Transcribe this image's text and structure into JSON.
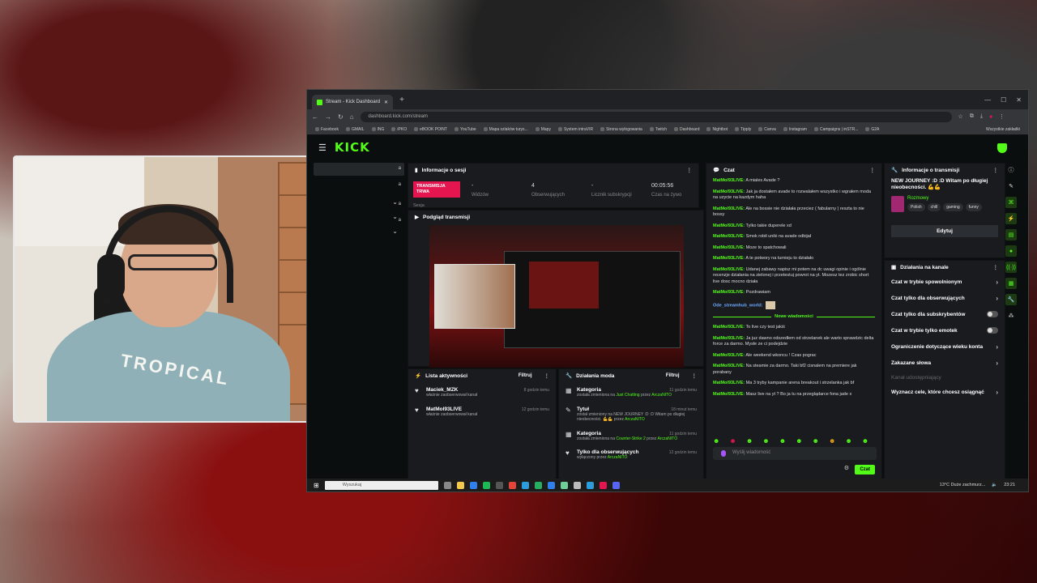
{
  "browser": {
    "tab_title": "Stream - Kick Dashboard",
    "url": "dashboard.kick.com/stream",
    "bookmarks": [
      "Facebook",
      "GMAIL",
      "ING",
      "iPKO",
      "eBOOK POINT",
      "YouTube",
      "Mapa szlaków turys...",
      "Mapy",
      "System intraVIR",
      "Strona wylogowania",
      "Twitch",
      "Dashboard",
      "Nightbot",
      "Tipply",
      "Canva",
      "Instagram",
      "Campaigns | inSTR...",
      "G2A"
    ],
    "bookmarks_other": "Wszystkie zakładki"
  },
  "app": {
    "logo": "KICK"
  },
  "sidebar": {
    "items": [
      "a",
      "a",
      "a",
      "a"
    ]
  },
  "session": {
    "title": "Informacje o sesji",
    "live_label": "TRANSMISJA TRWA",
    "session_label": "Sesja",
    "stats": [
      {
        "value": "-",
        "label": "Widzów"
      },
      {
        "value": "4",
        "label": "Obserwujących"
      },
      {
        "value": "-",
        "label": "Licznik subskrypcji"
      },
      {
        "value": "00:05:56",
        "label": "Czas na żywo"
      }
    ]
  },
  "preview": {
    "title": "Podgląd transmisji"
  },
  "activity": {
    "title": "Lista aktywności",
    "filter": "Filtruj",
    "items": [
      {
        "user": "Maciek_MZK",
        "text": "właśnie zaobserwował kanał",
        "time": "8 godzin temu"
      },
      {
        "user": "MatMol93LIVE",
        "text": "właśnie zaobserwował kanał",
        "time": "12 godzin temu"
      }
    ]
  },
  "mod": {
    "title": "Działania moda",
    "filter": "Filtruj",
    "items": [
      {
        "title": "Kategoria",
        "pre": "została zmieniona na ",
        "value": "Just Chatting",
        "mid": " przez ",
        "by": "ArczaNITO",
        "time": "11 godzin temu"
      },
      {
        "title": "Tytuł",
        "pre": "został zmieniony na NEW JOURNEY :D :D Witam po długiej nieobecności. 💪💪",
        "value": "",
        "mid": " przez ",
        "by": "ArczaNITO",
        "time": "18 minut temu"
      },
      {
        "title": "Kategoria",
        "pre": "została zmieniona na ",
        "value": "Counter-Strike 2",
        "mid": " przez ",
        "by": "ArczaNITO",
        "time": "11 godzin temu"
      },
      {
        "title": "Tylko dla obserwujących",
        "pre": "wyłączony przez ",
        "value": "",
        "mid": "",
        "by": "ArczaNITO",
        "time": "12 godzin temu"
      }
    ]
  },
  "chat": {
    "title": "Czat",
    "messages": [
      {
        "user": "MatMol93LIVE:",
        "text": "A miales Avade ?"
      },
      {
        "user": "MatMol93LIVE:",
        "text": "Jak ja dostałem avade to rozwalałem wszystko i wgrałem moda na uzycie na kazdym haha"
      },
      {
        "user": "MatMol93LIVE:",
        "text": "Ale na bossie nie działała przeciez ( fabularny ) reszta to nie bossy"
      },
      {
        "user": "MatMol93LIVE:",
        "text": "Tylko takie duperele xd"
      },
      {
        "user": "MatMol93LIVE:",
        "text": "Smok robił uniki na avade odbijał"
      },
      {
        "user": "MatMol93LIVE:",
        "text": "Moze to spatchowali"
      },
      {
        "user": "MatMol93LIVE:",
        "text": "A te potwory na turnieju to działało"
      },
      {
        "user": "MatMol93LIVE:",
        "text": "Udanej zabawy napisz mi potem na dc uwagi opinie i ogólnie recenzje działania na zielonej i przetestuj powrot na yt. Mozesz tez zrobic short live dosc mocno działa"
      },
      {
        "user": "MatMol93LIVE:",
        "text": "Pozdrawiam"
      },
      {
        "user": "Ode_streamhub_world:",
        "text": "",
        "alt": true
      }
    ],
    "new_label": "Nowe wiadomości",
    "messages_new": [
      {
        "user": "MatMol93LIVE:",
        "text": "To live czy test jakiś"
      },
      {
        "user": "MatMol93LIVE:",
        "text": "Ja juz dawno odszedłem od strzelanek ale warto sprawdzic delta force za darmo. Mysle ze ci podejdzie"
      },
      {
        "user": "MatMol93LIVE:",
        "text": "Ale weekend wkoncu ! Czas pograc"
      },
      {
        "user": "MatMol93LIVE:",
        "text": "Na steamie za darmo. Taki bf2 cisnalem na premiere jak porabany"
      },
      {
        "user": "MatMol93LIVE:",
        "text": "Ma 3 tryby kampanie arena breakout i strzelanka jak bf"
      },
      {
        "user": "MatMol93LIVE:",
        "text": "Masz live na yt ? Bo ja tu na przeglądarce fona jade x"
      }
    ],
    "input_placeholder": "Wyślij wiadomość",
    "send_label": "Czat"
  },
  "info": {
    "title": "Informacje o transmisji",
    "stream_title": "NEW JOURNEY :D :D Witam po długiej nieobecności. 💪💪",
    "category": "Rozmowy",
    "tags": [
      "Polish",
      "chill",
      "gaming",
      "funny",
      "I"
    ],
    "edit_label": "Edytuj"
  },
  "actions": {
    "title": "Działania na kanale",
    "items": [
      {
        "label": "Czat w trybie spowolnionym",
        "kind": "chevron"
      },
      {
        "label": "Czat tylko dla obserwujących",
        "kind": "chevron"
      },
      {
        "label": "Czat tylko dla subskrybentów",
        "kind": "toggle"
      },
      {
        "label": "Czat w trybie tylko emotek",
        "kind": "toggle"
      },
      {
        "label": "Ograniczenie dotyczące wieku konta",
        "kind": "chevron"
      },
      {
        "label": "Zakazane słowa",
        "kind": "chevron"
      },
      {
        "label": "Kanał udostępniający",
        "kind": "dim"
      },
      {
        "label": "Wyznacz cele, które chcesz osiągnąć",
        "kind": "chevron"
      }
    ]
  },
  "taskbar": {
    "search_placeholder": "Wyszukaj",
    "weather": "13°C Duże zachmurz...",
    "time": "23:21"
  },
  "webcam": {
    "shirt_text": "TROPICAL"
  }
}
